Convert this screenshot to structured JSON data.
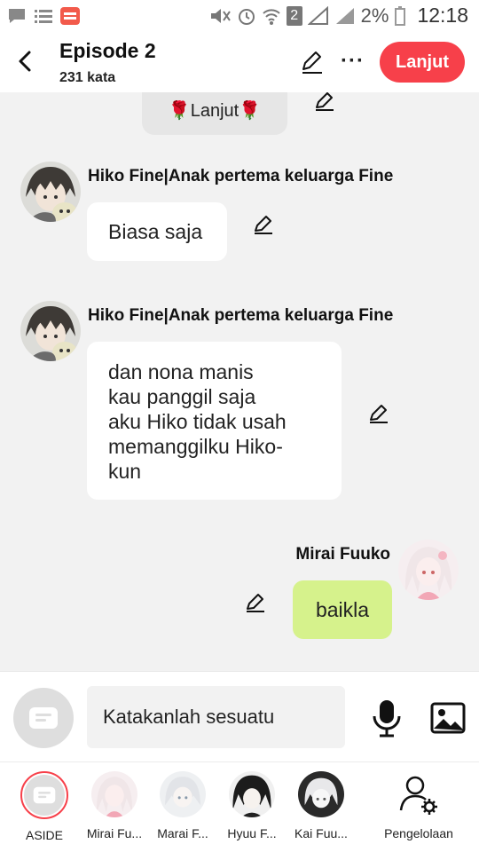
{
  "status_bar": {
    "battery_percent": "2%",
    "time": "12:18",
    "sim_label": "2"
  },
  "header": {
    "title": "Episode 2",
    "subtitle": "231 kata",
    "next_button": "Lanjut"
  },
  "chat": {
    "continue_card": "🌹Lanjut🌹",
    "messages": [
      {
        "sender": "Hiko Fine|Anak pertema keluarga Fine",
        "text": "Biasa saja",
        "side": "left"
      },
      {
        "sender": "Hiko Fine|Anak pertema keluarga Fine",
        "text": "dan nona manis\nkau panggil saja\naku Hiko tidak usah\nmemanggilku Hiko-\nkun",
        "side": "left"
      },
      {
        "sender": "Mirai Fuuko",
        "text": "baikla",
        "side": "right"
      }
    ]
  },
  "composer": {
    "placeholder": "Katakanlah sesuatu"
  },
  "characters": [
    {
      "label": "ASIDE"
    },
    {
      "label": "Mirai Fu..."
    },
    {
      "label": "Marai F..."
    },
    {
      "label": "Hyuu F..."
    },
    {
      "label": "Kai Fuu..."
    },
    {
      "label": "Pengelolaan"
    }
  ],
  "colors": {
    "accent": "#f7404a",
    "my_bubble": "#d6f28c",
    "bubble": "#ffffff",
    "background": "#f2f2f2"
  }
}
